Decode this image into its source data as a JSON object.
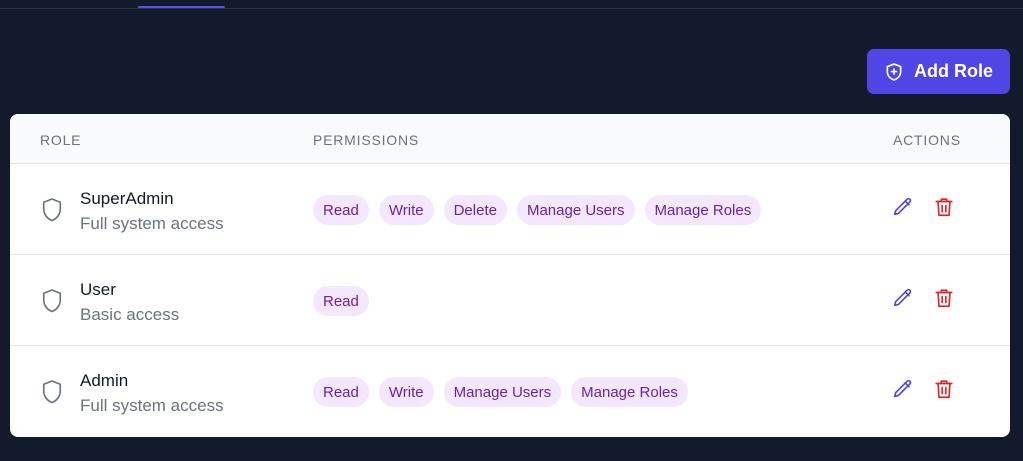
{
  "toolbar": {
    "add_role_label": "Add Role"
  },
  "table": {
    "headers": {
      "role": "ROLE",
      "permissions": "PERMISSIONS",
      "actions": "ACTIONS"
    },
    "rows": [
      {
        "name": "SuperAdmin",
        "description": "Full system access",
        "permissions": [
          "Read",
          "Write",
          "Delete",
          "Manage Users",
          "Manage Roles"
        ]
      },
      {
        "name": "User",
        "description": "Basic access",
        "permissions": [
          "Read"
        ]
      },
      {
        "name": "Admin",
        "description": "Full system access",
        "permissions": [
          "Read",
          "Write",
          "Manage Users",
          "Manage Roles"
        ]
      }
    ]
  },
  "icons": {
    "add": "shield-plus-icon",
    "role": "shield-icon",
    "edit": "pencil-icon",
    "delete": "trash-icon"
  },
  "colors": {
    "background": "#131a2b",
    "accent": "#4f46e5",
    "pill_bg": "#f3e8ff",
    "pill_text": "#6b21a8",
    "edit": "#4f46e5",
    "delete": "#dc2626"
  }
}
